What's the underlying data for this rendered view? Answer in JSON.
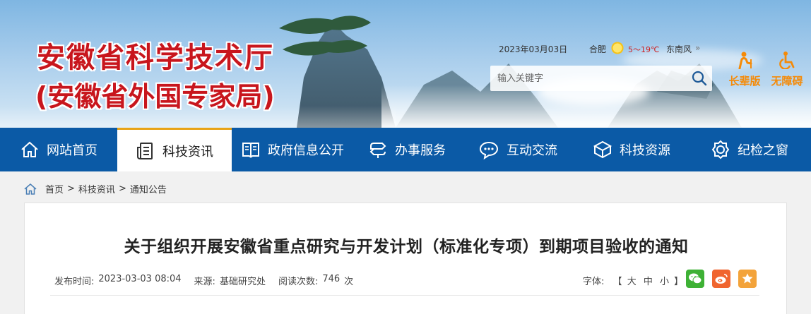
{
  "header": {
    "title": "安徽省科学技术厅",
    "subtitle": "(安徽省外国专家局)",
    "date": "2023年03月03日",
    "city": "合肥",
    "temperature": "5～19℃",
    "wind": "东南风",
    "wind_arrow": "»",
    "weather_icon": "sunny-cloudy-icon",
    "search": {
      "placeholder": "输入关键字"
    },
    "accessibility": [
      {
        "label": "长辈版",
        "icon": "elder-icon"
      },
      {
        "label": "无障碍",
        "icon": "wheelchair-icon"
      }
    ]
  },
  "nav": {
    "items": [
      {
        "label": "网站首页",
        "icon": "home-icon"
      },
      {
        "label": "科技资讯",
        "icon": "news-icon"
      },
      {
        "label": "政府信息公开",
        "icon": "book-icon"
      },
      {
        "label": "办事服务",
        "icon": "service-icon"
      },
      {
        "label": "互动交流",
        "icon": "chat-icon"
      },
      {
        "label": "科技资源",
        "icon": "cube-icon"
      },
      {
        "label": "纪检之窗",
        "icon": "badge-icon"
      }
    ],
    "active_index": 1
  },
  "breadcrumb": {
    "items": [
      "首页",
      "科技资讯",
      "通知公告"
    ],
    "separator": ">"
  },
  "article": {
    "title": "关于组织开展安徽省重点研究与开发计划（标准化专项）到期项目验收的通知",
    "publish_label": "发布时间:",
    "publish_time": "2023-03-03 08:04",
    "source_label": "来源:",
    "source": "基础研究处",
    "views_label": "阅读次数:",
    "views": "746",
    "views_unit": "次",
    "font_label": "字体:",
    "font_open": "【",
    "font_large": "大",
    "font_medium": "中",
    "font_small": "小",
    "font_close": "】",
    "share": [
      "wechat-icon",
      "weibo-icon",
      "favorite-icon"
    ]
  },
  "colors": {
    "nav_bg": "#0b5aa6",
    "title_red": "#c8161d",
    "accent_orange": "#f58a07"
  }
}
